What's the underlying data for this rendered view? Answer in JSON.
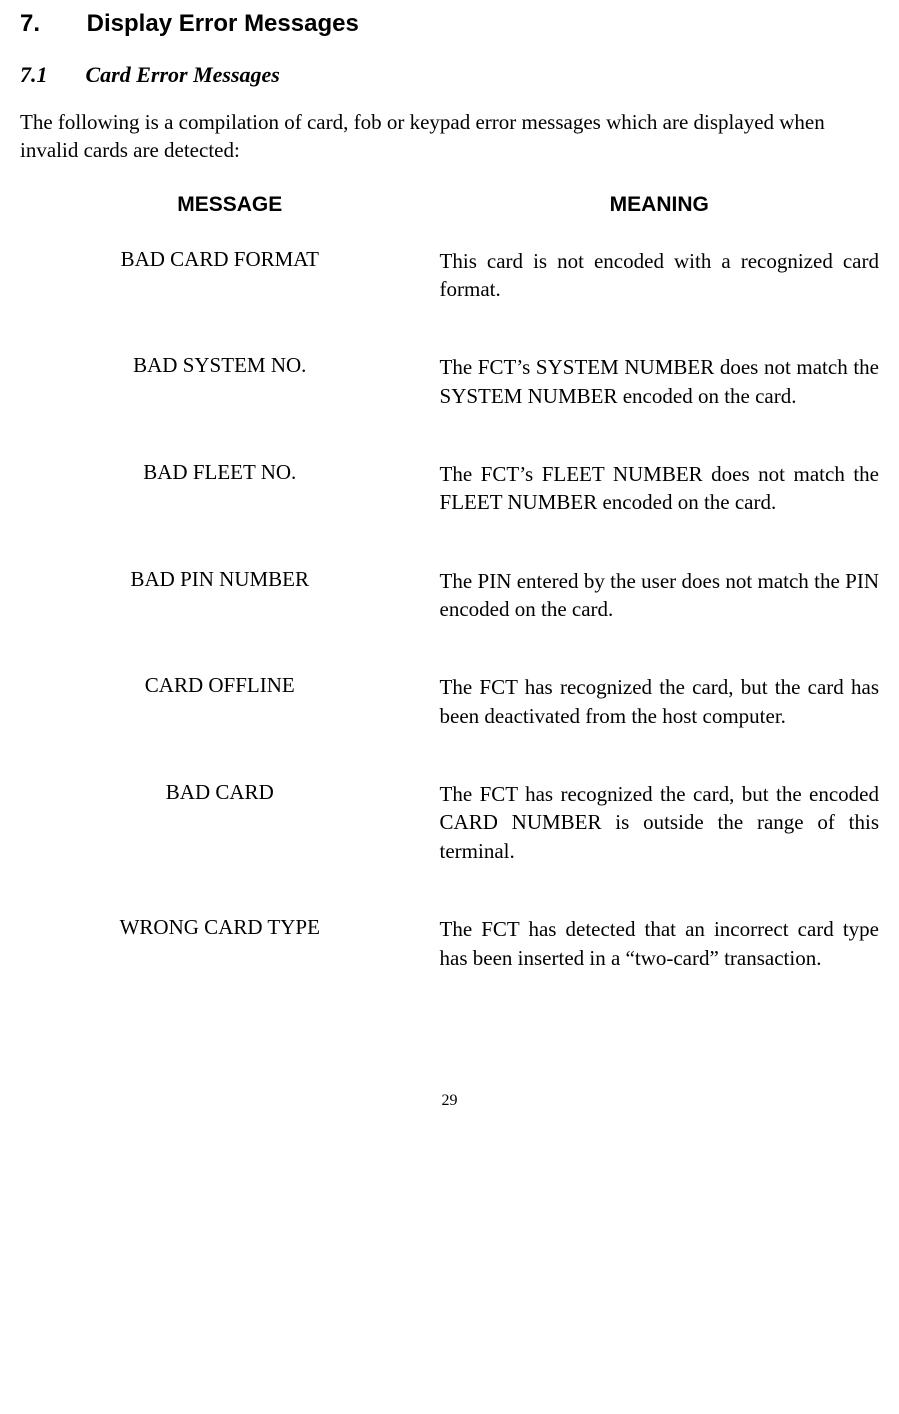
{
  "section": {
    "number": "7.",
    "title": "Display Error Messages"
  },
  "subsection": {
    "number": "7.1",
    "title": "Card Error Messages"
  },
  "intro": "The following is a compilation of card, fob or keypad error messages which are displayed when invalid cards are detected:",
  "headers": {
    "message": "MESSAGE",
    "meaning": "MEANING"
  },
  "rows": [
    {
      "message": "BAD CARD FORMAT",
      "meaning": "This card is not encoded with a recognized card format."
    },
    {
      "message": "BAD SYSTEM NO.",
      "meaning": "The FCT’s SYSTEM NUMBER does not match the SYSTEM NUMBER encoded on the card."
    },
    {
      "message": "BAD FLEET NO.",
      "meaning": "The FCT’s FLEET NUMBER does not match the FLEET NUMBER encoded on the card."
    },
    {
      "message": "BAD PIN NUMBER",
      "meaning": "The PIN entered by the user does not match the PIN encoded on the card."
    },
    {
      "message": "CARD OFFLINE",
      "meaning": "The FCT has recognized the card, but the card has been deactivated from the host computer."
    },
    {
      "message": "BAD CARD",
      "meaning": "The FCT has recognized the card, but the encoded CARD NUMBER is outside the range of this terminal."
    },
    {
      "message": "WRONG CARD TYPE",
      "meaning": "The FCT has detected that an incorrect card type has been inserted in a “two-card” transaction."
    }
  ],
  "pageNumber": "29"
}
